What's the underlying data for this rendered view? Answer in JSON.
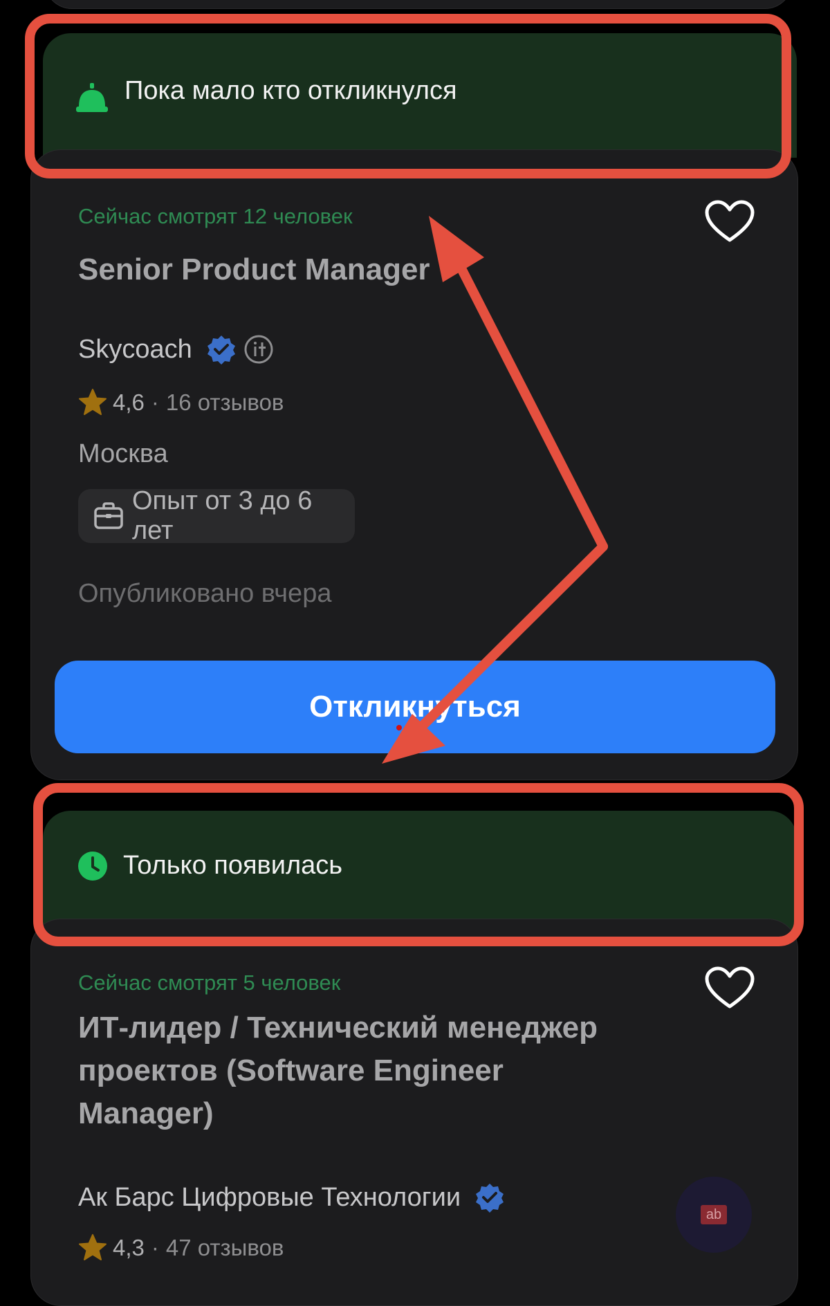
{
  "colors": {
    "accent_blue": "#2d7ff9",
    "banner_green": "#18301d",
    "viewing_green": "#2f8b53",
    "highlight_red": "#e5503f",
    "verified_blue": "#3b6fc9",
    "star": "#a0700f"
  },
  "banners": {
    "first": {
      "icon": "bell-icon",
      "label": "Пока мало кто откликнулся"
    },
    "second": {
      "icon": "clock-icon",
      "label": "Только появилась"
    }
  },
  "vacancies": [
    {
      "viewing": "Сейчас смотрят 12 человек",
      "title": "Senior Product Manager",
      "company": "Skycoach",
      "rating": "4,6",
      "reviews": "16 отзывов",
      "city": "Москва",
      "experience": "Опыт от 3 до 6 лет",
      "published": "Опубликовано вчера",
      "apply_label": "Откликнуться"
    },
    {
      "viewing": "Сейчас смотрят 5 человек",
      "title_lines": [
        "ИТ-лидер / Технический менеджер",
        "проектов (Software Engineer",
        "Manager)"
      ],
      "company": "Ак Барс Цифровые Технологии",
      "rating": "4,3",
      "reviews": "47 отзывов",
      "avatar_text": "ab"
    }
  ],
  "rating_separator": "·"
}
